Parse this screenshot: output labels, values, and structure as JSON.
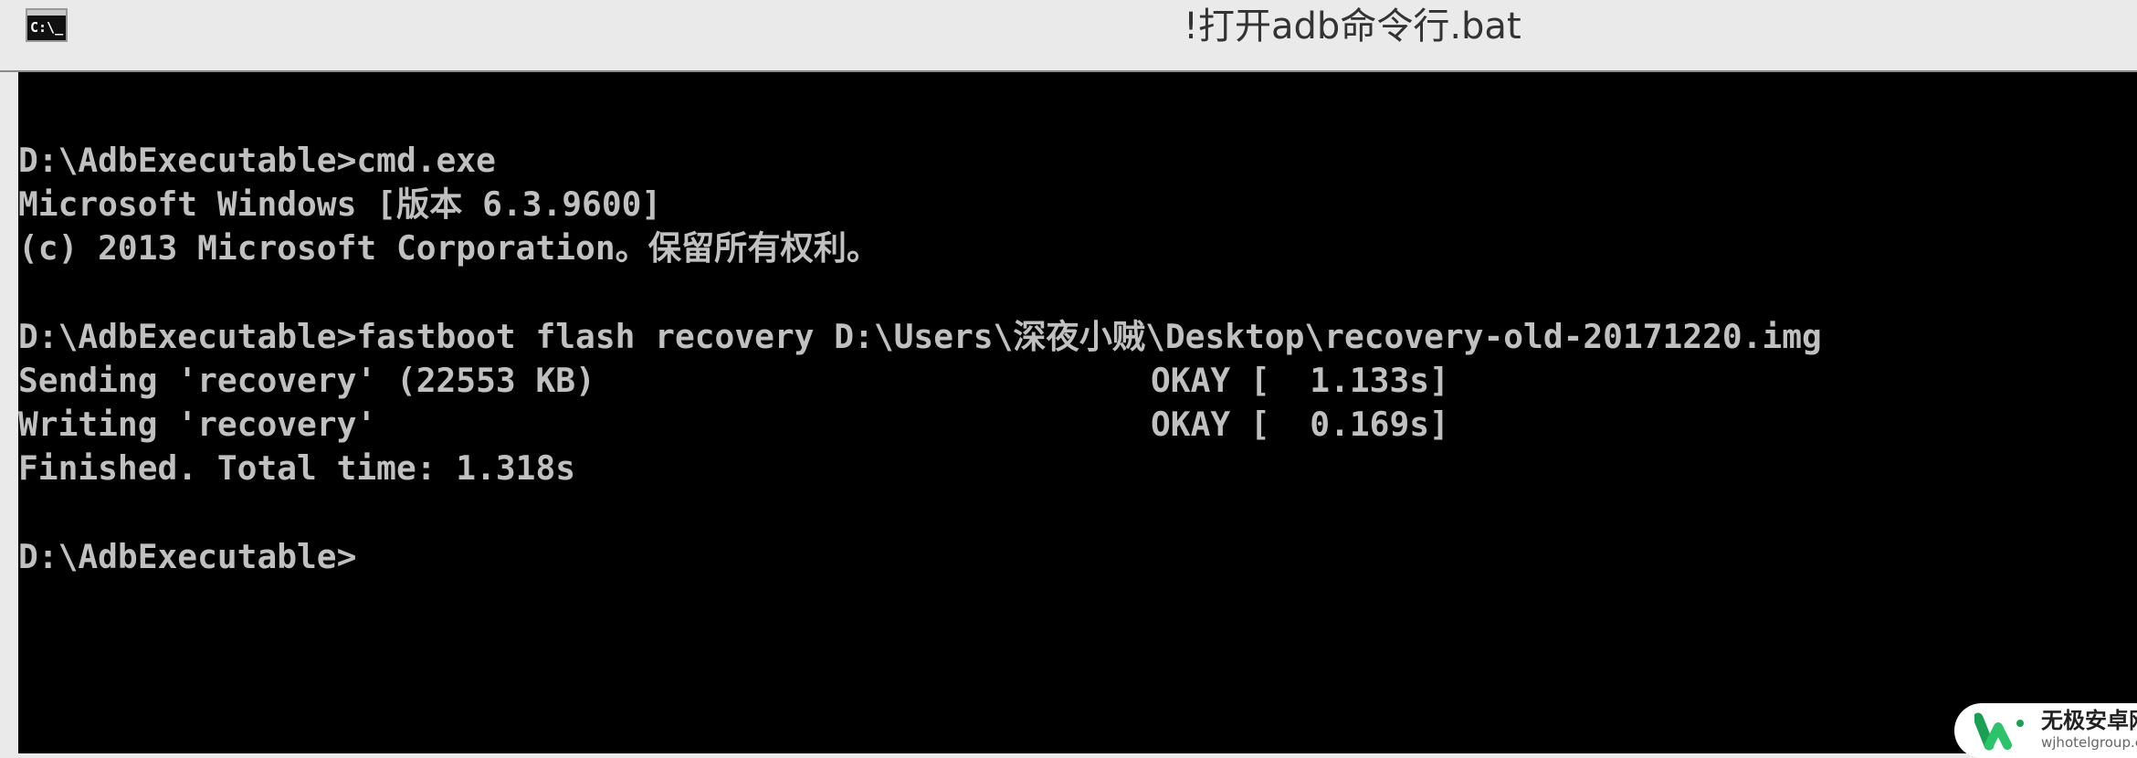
{
  "window": {
    "icon": "cmd-icon",
    "icon_glyph": "C:\\_",
    "title": "!打开adb命令行.bat"
  },
  "console": {
    "lines": [
      "D:\\AdbExecutable>cmd.exe",
      "Microsoft Windows [版本 6.3.9600]",
      "(c) 2013 Microsoft Corporation。保留所有权利。",
      "",
      "D:\\AdbExecutable>fastboot flash recovery D:\\Users\\深夜小贼\\Desktop\\recovery-old-20171220.img",
      "Sending 'recovery' (22553 KB)",
      "Writing 'recovery'",
      "Finished. Total time: 1.318s",
      "",
      "D:\\AdbExecutable>"
    ],
    "status": {
      "sending": "OKAY [  1.133s]",
      "writing": "OKAY [  0.169s]"
    }
  },
  "watermark": {
    "name": "无极安卓网",
    "url": "wjhotelgroup.com",
    "brand_color": "#1aa052"
  }
}
